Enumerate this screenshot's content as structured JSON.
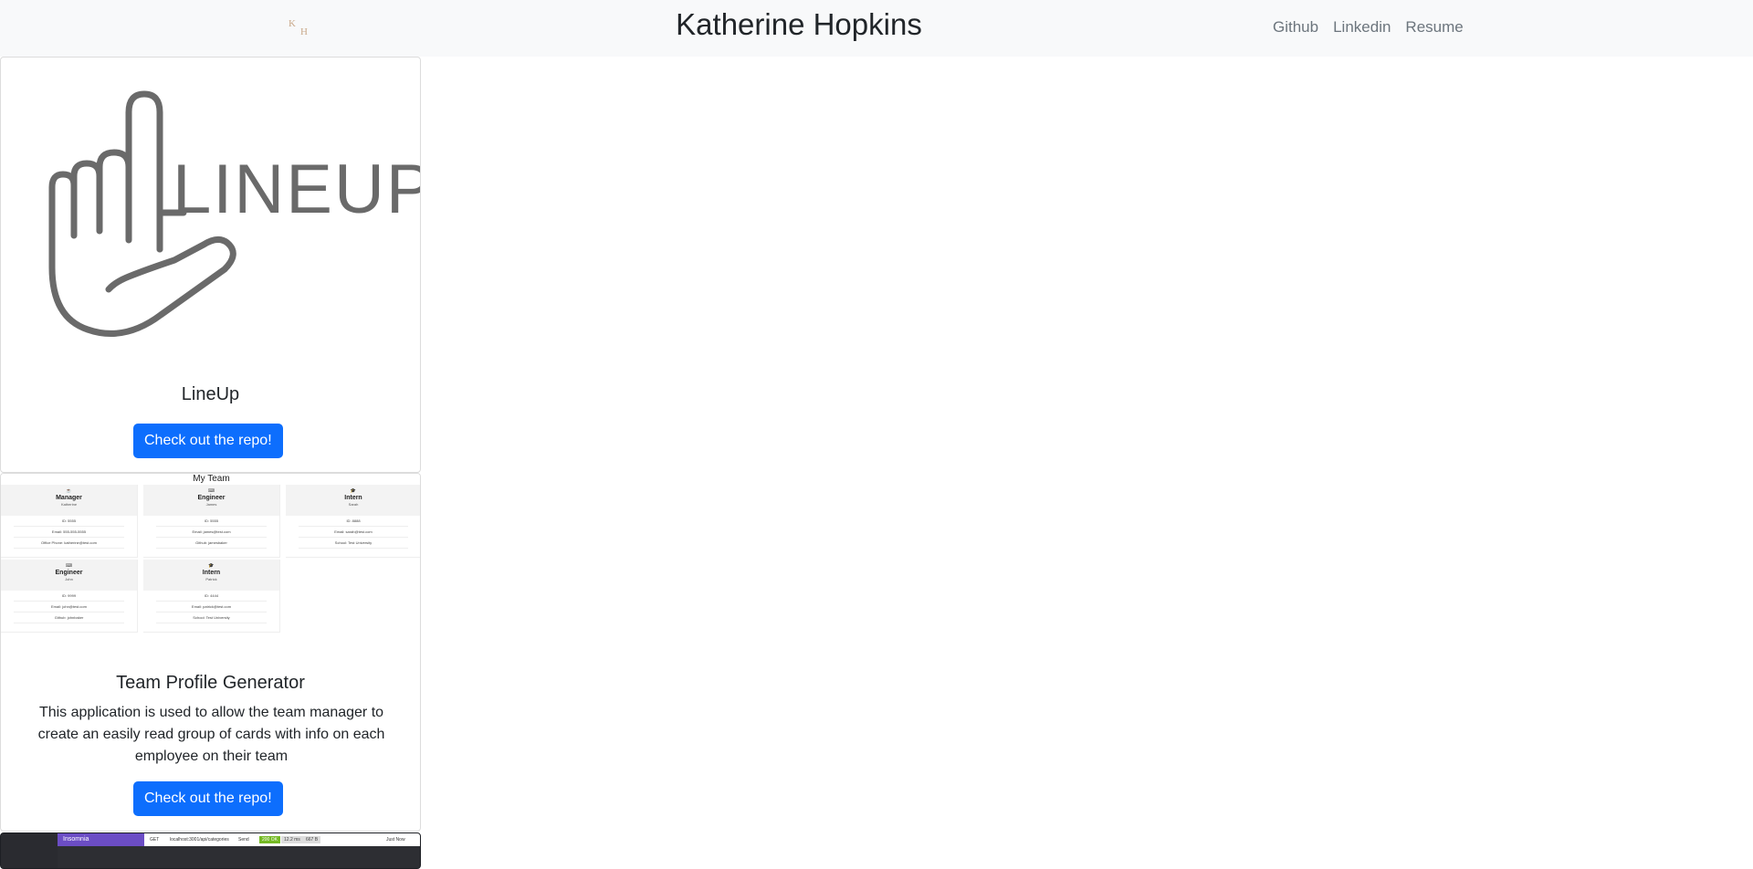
{
  "header": {
    "logo_letters": {
      "top": "K",
      "bottom": "H"
    },
    "title": "Katherine Hopkins",
    "nav": [
      {
        "label": "Github"
      },
      {
        "label": "Linkedin"
      },
      {
        "label": "Resume"
      }
    ]
  },
  "projects": [
    {
      "logo_text": "LINEUP",
      "title": "LineUp",
      "description": "",
      "button_label": "Check out the repo!"
    },
    {
      "screenshot": {
        "heading": "My Team",
        "cards": [
          {
            "icon": "☕",
            "role": "Manager",
            "name": "Katherine",
            "rows": [
              "ID: 5555",
              "Email: 555-555-5555",
              "Office Phone: katherine@test.com"
            ]
          },
          {
            "icon": "⌨",
            "role": "Engineer",
            "name": "James",
            "rows": [
              "ID: 5555",
              "Email: james@test.com",
              "Github: jamesbaker"
            ]
          },
          {
            "icon": "🎓",
            "role": "Intern",
            "name": "Sarah",
            "rows": [
              "ID: 8888",
              "Email: sarah@test.com",
              "School: Test University"
            ]
          },
          {
            "icon": "⌨",
            "role": "Engineer",
            "name": "John",
            "rows": [
              "ID: 9999",
              "Email: john@test.com",
              "Github: johnbaker"
            ]
          },
          {
            "icon": "🎓",
            "role": "Intern",
            "name": "Patrick",
            "rows": [
              "ID: 4444",
              "Email: patrick@test.com",
              "School: Test University"
            ]
          }
        ]
      },
      "title": "Team Profile Generator",
      "description": "This application is used to allow the team manager to create an easily read group of cards with info on each employee on their team",
      "button_label": "Check out the repo!"
    },
    {
      "screenshot": {
        "app_name": "Insomnia",
        "method": "GET",
        "url": "localhost:3001/api/categories",
        "send": "Send",
        "status": "200 OK",
        "time": "12.2 ms",
        "size": "667 B",
        "when": "Just Now"
      }
    }
  ]
}
